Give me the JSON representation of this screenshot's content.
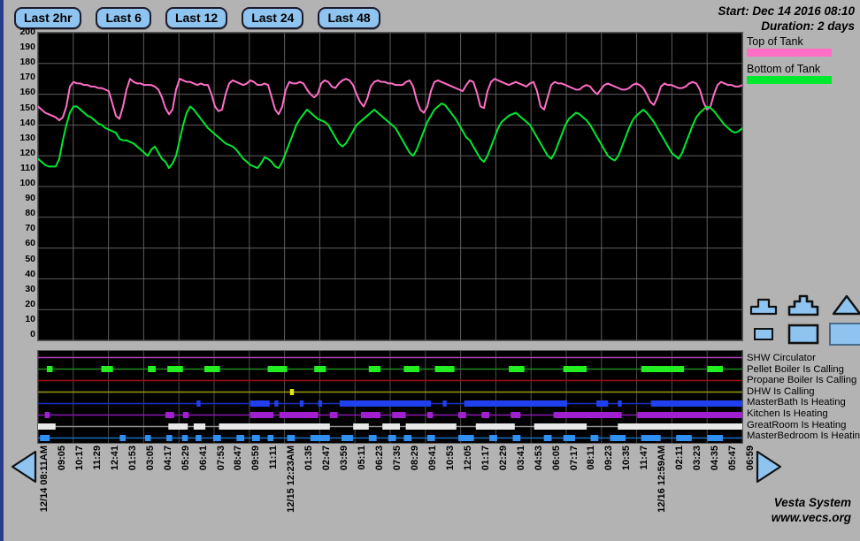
{
  "toolbar": {
    "buttons": [
      {
        "label": "Last 2hr"
      },
      {
        "label": "Last 6"
      },
      {
        "label": "Last 12"
      },
      {
        "label": "Last 24"
      },
      {
        "label": "Last 48"
      }
    ]
  },
  "header": {
    "start": "Start: Dec 14 2016 08:10",
    "duration": "Duration: 2 days"
  },
  "legend": {
    "items": [
      {
        "label": "Top of Tank",
        "color": "#ff6ec7"
      },
      {
        "label": "Bottom of Tank",
        "color": "#00e830"
      }
    ]
  },
  "size_icons": {
    "names": [
      "small-scale-icon",
      "medium-scale-icon",
      "large-scale-icon",
      "small-box-icon",
      "medium-box-icon",
      "large-box-icon"
    ]
  },
  "status": {
    "rows": [
      {
        "label": "SHW Circulator",
        "color": "#a020a0",
        "line": "#b040b0"
      },
      {
        "label": "Pellet Boiler Is Calling",
        "color": "#22ee22",
        "line": "#1d8a1d"
      },
      {
        "label": "Propane Boiler Is Calling",
        "color": "#e02020",
        "line": "#a01010"
      },
      {
        "label": "DHW Is Calling",
        "color": "#e8e800",
        "line": "#9a9a10"
      },
      {
        "label": "MasterBath Is Heating",
        "color": "#2040f0",
        "line": "#1830c0"
      },
      {
        "label": "Kitchen Is Heating",
        "color": "#a020d0",
        "line": "#8a18b0"
      },
      {
        "label": "GreatRoom Is Heating",
        "color": "#e8e8e8",
        "line": "#909090"
      },
      {
        "label": "MasterBedroom Is Heatin",
        "color": "#3090f0",
        "line": "#1c6ec0"
      }
    ]
  },
  "navigation": {
    "prev": "prev-arrow",
    "next": "next-arrow"
  },
  "footer": {
    "line1": "Vesta System",
    "line2": "www.vecs.org"
  },
  "chart_data": {
    "type": "line",
    "title": "",
    "xlabel": "",
    "ylabel": "",
    "ylim": [
      0,
      200
    ],
    "ytick_step": 10,
    "yticks": [
      200,
      190,
      180,
      170,
      160,
      150,
      140,
      130,
      120,
      110,
      100,
      90,
      80,
      70,
      60,
      50,
      40,
      30,
      20,
      10,
      0
    ],
    "grid": true,
    "background": "#000000",
    "xticks": [
      "12/14 08:11AM",
      "09:05",
      "10:17",
      "11:29",
      "12:41",
      "01:53",
      "03:05",
      "04:17",
      "05:29",
      "06:41",
      "07:53",
      "08:47",
      "09:59",
      "11:11",
      "12/15 12:23AM",
      "01:35",
      "02:47",
      "03:59",
      "05:11",
      "06:23",
      "07:35",
      "08:29",
      "09:41",
      "10:53",
      "12:05",
      "01:17",
      "02:29",
      "03:41",
      "04:53",
      "06:05",
      "07:17",
      "08:11",
      "09:23",
      "10:35",
      "11:47",
      "12/16 12:59AM",
      "02:11",
      "03:23",
      "04:35",
      "05:47",
      "06:59"
    ],
    "series": [
      {
        "name": "Top of Tank",
        "color": "#ff6ec7",
        "values": [
          152,
          150,
          148,
          147,
          146,
          145,
          143,
          145,
          152,
          165,
          168,
          167,
          167,
          166,
          166,
          165,
          165,
          164,
          164,
          163,
          162,
          154,
          146,
          144,
          152,
          163,
          170,
          168,
          167,
          167,
          166,
          166,
          166,
          165,
          163,
          158,
          151,
          147,
          150,
          163,
          170,
          169,
          168,
          168,
          167,
          166,
          167,
          166,
          166,
          160,
          152,
          149,
          150,
          160,
          167,
          169,
          168,
          167,
          166,
          167,
          169,
          168,
          166,
          166,
          167,
          166,
          158,
          150,
          147,
          152,
          163,
          168,
          167,
          167,
          168,
          167,
          163,
          160,
          158,
          160,
          167,
          169,
          168,
          165,
          164,
          167,
          169,
          170,
          169,
          166,
          160,
          155,
          152,
          157,
          165,
          168,
          169,
          168,
          168,
          167,
          167,
          166,
          166,
          166,
          168,
          169,
          165,
          156,
          150,
          148,
          152,
          162,
          168,
          169,
          168,
          167,
          166,
          165,
          164,
          163,
          162,
          166,
          169,
          168,
          161,
          152,
          151,
          162,
          168,
          170,
          169,
          168,
          167,
          166,
          167,
          168,
          167,
          166,
          165,
          167,
          168,
          162,
          152,
          150,
          158,
          166,
          168,
          167,
          167,
          166,
          165,
          164,
          163,
          163,
          165,
          166,
          165,
          162,
          160,
          163,
          166,
          167,
          166,
          165,
          164,
          163,
          163,
          164,
          166,
          167,
          166,
          164,
          160,
          155,
          153,
          158,
          165,
          167,
          166,
          166,
          165,
          164,
          164,
          165,
          167,
          168,
          167,
          163,
          155,
          150,
          152,
          160,
          166,
          168,
          167,
          166,
          166,
          165,
          165,
          166
        ]
      },
      {
        "name": "Bottom of Tank",
        "color": "#00e830",
        "values": [
          118,
          116,
          114,
          113,
          113,
          113,
          118,
          130,
          140,
          148,
          152,
          152,
          150,
          148,
          146,
          145,
          143,
          141,
          140,
          138,
          137,
          136,
          135,
          131,
          130,
          130,
          129,
          128,
          126,
          124,
          122,
          120,
          124,
          126,
          122,
          118,
          116,
          112,
          115,
          120,
          130,
          140,
          148,
          152,
          150,
          147,
          144,
          141,
          138,
          136,
          134,
          132,
          130,
          128,
          127,
          126,
          124,
          121,
          118,
          116,
          114,
          113,
          112,
          115,
          119,
          118,
          116,
          113,
          112,
          116,
          122,
          128,
          134,
          140,
          144,
          147,
          150,
          148,
          146,
          144,
          143,
          142,
          140,
          136,
          132,
          128,
          126,
          128,
          132,
          136,
          140,
          142,
          144,
          146,
          148,
          150,
          148,
          146,
          144,
          142,
          140,
          138,
          134,
          130,
          126,
          122,
          120,
          124,
          130,
          136,
          142,
          146,
          150,
          152,
          154,
          153,
          150,
          147,
          144,
          140,
          136,
          132,
          130,
          126,
          122,
          118,
          116,
          120,
          126,
          132,
          138,
          142,
          144,
          146,
          147,
          148,
          146,
          144,
          142,
          140,
          136,
          132,
          128,
          124,
          120,
          118,
          122,
          128,
          134,
          140,
          144,
          146,
          148,
          147,
          145,
          143,
          140,
          136,
          132,
          128,
          124,
          120,
          118,
          117,
          120,
          126,
          132,
          138,
          143,
          146,
          148,
          150,
          148,
          145,
          142,
          138,
          134,
          130,
          126,
          122,
          120,
          118,
          122,
          128,
          134,
          140,
          145,
          148,
          150,
          152,
          151,
          149,
          146,
          143,
          140,
          138,
          136,
          135,
          136,
          138
        ]
      }
    ]
  },
  "status_data": {
    "rows": [
      {
        "name": "SHW Circulator",
        "segments": []
      },
      {
        "name": "Pellet Boiler Is Calling",
        "segments": [
          [
            0.045,
            0.075
          ],
          [
            0.325,
            0.385
          ],
          [
            0.565,
            0.605
          ],
          [
            0.665,
            0.745
          ],
          [
            0.855,
            0.935
          ],
          [
            1.18,
            1.28
          ],
          [
            1.42,
            1.48
          ],
          [
            1.7,
            1.76
          ],
          [
            1.88,
            1.96
          ],
          [
            2.04,
            2.14
          ],
          [
            2.42,
            2.5
          ],
          [
            2.7,
            2.82
          ],
          [
            3.1,
            3.32
          ],
          [
            3.44,
            3.52
          ]
        ]
      },
      {
        "name": "Propane Boiler Is Calling",
        "segments": []
      },
      {
        "name": "DHW Is Calling",
        "segments": [
          [
            1.295,
            1.315
          ]
        ]
      },
      {
        "name": "MasterBath Is Heating",
        "segments": [
          [
            0.815,
            0.835
          ],
          [
            1.09,
            1.19
          ],
          [
            1.215,
            1.235
          ],
          [
            1.345,
            1.365
          ],
          [
            1.44,
            1.46
          ],
          [
            1.55,
            2.02
          ],
          [
            2.08,
            2.1
          ],
          [
            2.19,
            2.72
          ],
          [
            2.87,
            2.93
          ],
          [
            2.98,
            3.0
          ],
          [
            3.15,
            3.62
          ]
        ]
      },
      {
        "name": "Kitchen Is Heating",
        "segments": [
          [
            0.035,
            0.06
          ],
          [
            0.655,
            0.7
          ],
          [
            0.745,
            0.775
          ],
          [
            1.09,
            1.21
          ],
          [
            1.24,
            1.44
          ],
          [
            1.5,
            1.54
          ],
          [
            1.66,
            1.76
          ],
          [
            1.82,
            1.89
          ],
          [
            2.0,
            2.03
          ],
          [
            2.16,
            2.2
          ],
          [
            2.28,
            2.32
          ],
          [
            2.43,
            2.48
          ],
          [
            2.65,
            3.0
          ],
          [
            3.08,
            3.62
          ]
        ]
      },
      {
        "name": "GreatRoom Is Heating",
        "segments": [
          [
            0.0,
            0.09
          ],
          [
            0.67,
            0.77
          ],
          [
            0.8,
            0.86
          ],
          [
            0.93,
            1.5
          ],
          [
            1.62,
            1.7
          ],
          [
            1.77,
            1.86
          ],
          [
            1.89,
            2.15
          ],
          [
            2.25,
            2.45
          ],
          [
            2.55,
            2.82
          ],
          [
            2.98,
            3.62
          ]
        ]
      },
      {
        "name": "MasterBedroom Is Heating",
        "segments": [
          [
            0.01,
            0.06
          ],
          [
            0.42,
            0.45
          ],
          [
            0.55,
            0.58
          ],
          [
            0.66,
            0.69
          ],
          [
            0.74,
            0.77
          ],
          [
            0.81,
            0.84
          ],
          [
            0.9,
            0.94
          ],
          [
            1.02,
            1.06
          ],
          [
            1.1,
            1.14
          ],
          [
            1.18,
            1.21
          ],
          [
            1.28,
            1.32
          ],
          [
            1.4,
            1.5
          ],
          [
            1.56,
            1.62
          ],
          [
            1.7,
            1.74
          ],
          [
            1.8,
            1.84
          ],
          [
            1.88,
            1.92
          ],
          [
            2.0,
            2.04
          ],
          [
            2.16,
            2.24
          ],
          [
            2.32,
            2.36
          ],
          [
            2.44,
            2.48
          ],
          [
            2.6,
            2.64
          ],
          [
            2.7,
            2.76
          ],
          [
            2.84,
            2.88
          ],
          [
            2.94,
            3.02
          ],
          [
            3.1,
            3.2
          ],
          [
            3.28,
            3.36
          ],
          [
            3.44,
            3.52
          ]
        ]
      }
    ]
  }
}
